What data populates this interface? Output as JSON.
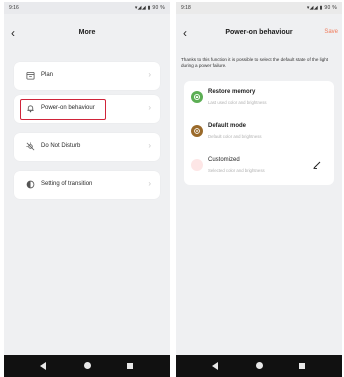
{
  "left": {
    "status": {
      "time": "9:16",
      "icons": "▾◢◢ ▮ 90 %"
    },
    "header": {
      "back": "‹",
      "title": "More"
    },
    "items": [
      {
        "label": "Plan"
      },
      {
        "label": "Power-on behaviour"
      },
      {
        "label": "Do Not Disturb"
      },
      {
        "label": "Setting of transition"
      }
    ]
  },
  "right": {
    "status": {
      "time": "9:18",
      "icons": "▾◢◢ ▮ 90 %"
    },
    "header": {
      "back": "‹",
      "title": "Power-on behaviour",
      "save": "Save"
    },
    "intro": "Thanks to this function it is possible to select the default state of the light during a power failure.",
    "options": [
      {
        "title": "Restore memory",
        "subtitle": "Last used color and brightness",
        "color": "#5cae54"
      },
      {
        "title": "Default mode",
        "subtitle": "Default color and brightness",
        "color": "#9a6a2a"
      },
      {
        "title": "Customized",
        "subtitle": "Selected color and brightness",
        "color": "#fde6e6"
      }
    ]
  },
  "colors": {
    "accent": "#f07a5a",
    "highlight": "#d0243a"
  }
}
